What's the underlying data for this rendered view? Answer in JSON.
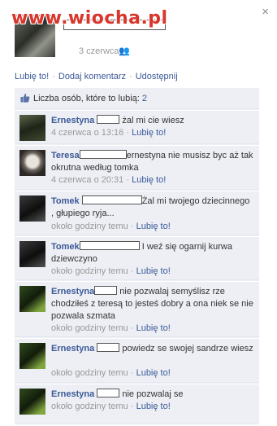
{
  "watermark": "www.wiocha.pl",
  "close_symbol": "×",
  "post": {
    "date": "3 czerwca",
    "audience_icon": "friends-icon",
    "audience_symbol": "👥"
  },
  "actions": {
    "like": "Lubię to!",
    "comment": "Dodaj komentarz",
    "share": "Udostępnij",
    "separator": "·"
  },
  "likes": {
    "label": "Liczba osób, które to lubią:",
    "count": "2"
  },
  "comments": [
    {
      "author": "Ernestyna",
      "text": "żal mi cie wiesz",
      "time": "4 czerwca o 13:16",
      "like": "Lubię to!"
    },
    {
      "author": "Teresa",
      "text": "ernestyna nie musisz byc aż tak okrutna według tomka",
      "time": "4 czerwca o 20:31",
      "like": "Lubię to!"
    },
    {
      "author": "Tomek",
      "text": "Żal mi twojego dziecinnego , głupiego ryja...",
      "time": "około godziny temu",
      "like": "Lubię to!"
    },
    {
      "author": "Tomek",
      "text": "I weź się ogarnij kurwa dziewczyno",
      "time": "około godziny temu",
      "like": "Lubię to!"
    },
    {
      "author": "Ernestyna",
      "text": "nie pozwalaj semyślisz rze chodziłeś z teresą to jesteś dobry a ona niek se nie pozwala szmata",
      "time": "około godziny temu",
      "like": "Lubię to!"
    },
    {
      "author": "Ernestyna",
      "text": "powiedz se swojej sandrze wiesz",
      "time": "około godziny temu",
      "like": "Lubię to!"
    },
    {
      "author": "Ernestyna",
      "text": "nie pozwalaj se",
      "time": "około godziny temu",
      "like": "Lubię to!"
    }
  ],
  "meta_separator": "·",
  "colors": {
    "link": "#3b5998",
    "panel": "#edeff4",
    "watermark": "#d9362b"
  }
}
